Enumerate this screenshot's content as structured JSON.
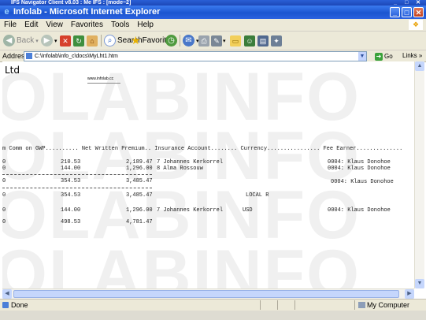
{
  "outer_window": {
    "title": "IFS Navigator Client v8.03 : Me IFS :  [mode~2]"
  },
  "window": {
    "title": "Infolab - Microsoft Internet Explorer",
    "buttons": [
      "_",
      "□",
      "✕"
    ]
  },
  "menu": [
    "File",
    "Edit",
    "View",
    "Favorites",
    "Tools",
    "Help"
  ],
  "toolbar": {
    "back": "Back",
    "search": "Search",
    "favorites": "Favorites"
  },
  "address": {
    "label": "Address",
    "url": "C:\\Infolab\\info_c\\docs\\MyLht1.htm",
    "go": "Go",
    "links": "Links"
  },
  "page": {
    "watermark_rows": [
      "OLABINFO",
      "OLABINFO",
      "OLABINFO",
      "OLABINFO"
    ],
    "company": "Ltd",
    "website": "www.infolab.cc",
    "header": "m Comm on GWP.......... Net Written Premium.. Insurance Account........ Currency................ Fee Earner..............",
    "rows": [
      {
        "c0": "0",
        "comm": "210.53",
        "nwp": "2,189.47",
        "account": "7 Johannes Kerkorrel",
        "currency": "",
        "fee": "0004: Klaus Donohoe"
      },
      {
        "c0": "0",
        "comm": "144.00",
        "nwp": "1,296.00",
        "account": "8 Alma Rossouw",
        "currency": "",
        "fee": "0004: Klaus Donohoe"
      },
      {
        "c0": "0",
        "comm": "354.53",
        "nwp": "3,485.47",
        "account": "",
        "currency": "",
        "fee": "0004: Klaus Donohoe"
      },
      {
        "c0": "0",
        "comm": "354.53",
        "nwp": "3,485.47",
        "account": "",
        "currency": "LOCAL R",
        "fee": ""
      },
      {
        "c0": "0",
        "comm": "144.00",
        "nwp": "1,296.00",
        "account": "7 Johannes Kerkorrel",
        "currency": "USD",
        "fee": "0004: Klaus Donohoe"
      },
      {
        "c0": "0",
        "comm": "498.53",
        "nwp": "4,781.47",
        "account": "",
        "currency": "",
        "fee": ""
      }
    ]
  },
  "status": {
    "left": "Done",
    "right": "My Computer"
  }
}
